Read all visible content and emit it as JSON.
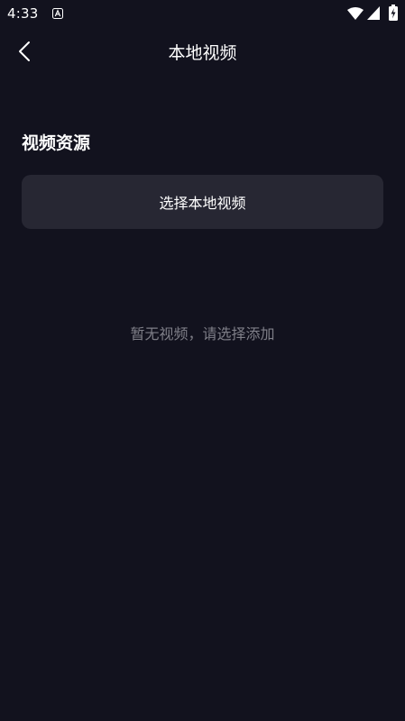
{
  "status_bar": {
    "time": "4:33"
  },
  "header": {
    "title": "本地视频"
  },
  "section": {
    "title": "视频资源"
  },
  "select_button": {
    "label": "选择本地视频"
  },
  "empty_state": {
    "message": "暂无视频，请选择添加"
  },
  "icons": {
    "back": "chevron-left-icon",
    "app_indicator": "app-a-icon",
    "wifi": "wifi-icon",
    "signal": "signal-icon",
    "battery": "battery-charging-icon"
  },
  "colors": {
    "background": "#12121e",
    "button_background": "#272733",
    "muted_text": "#7f7f88",
    "text": "#ffffff"
  }
}
